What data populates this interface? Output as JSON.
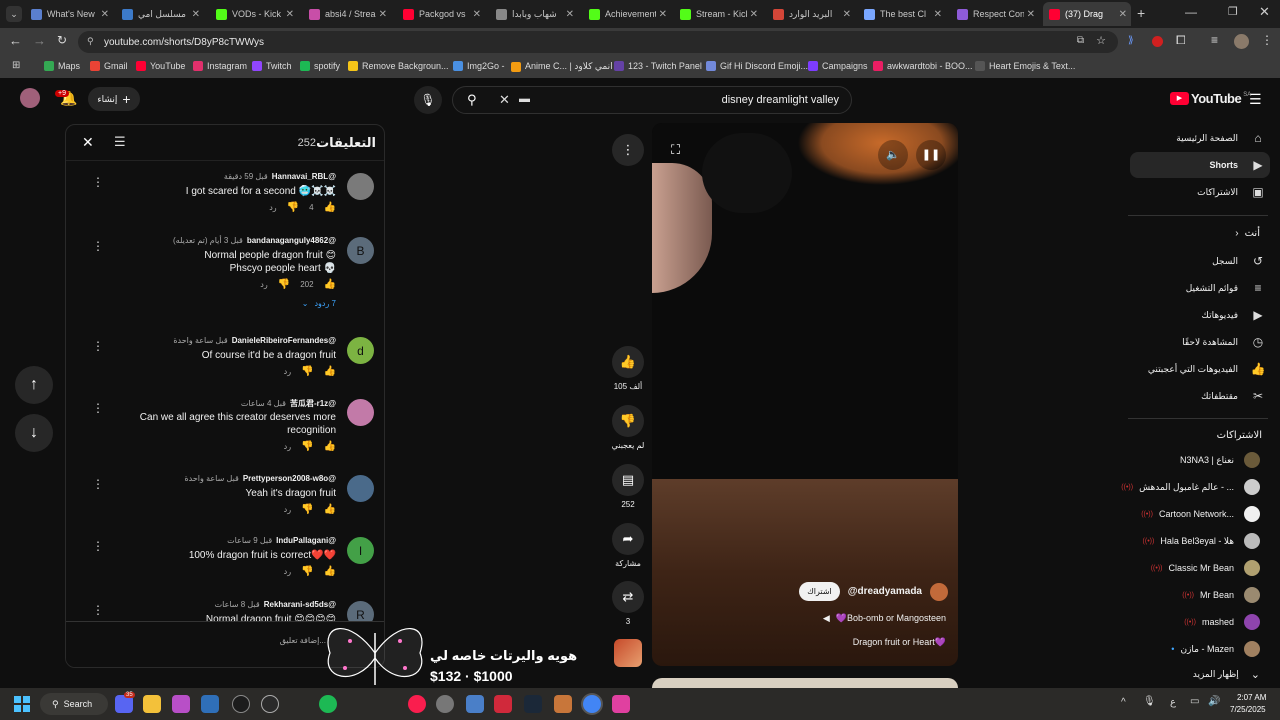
{
  "browser": {
    "tabs": [
      {
        "title": "What's New",
        "color": "#5a7fcf"
      },
      {
        "title": "مسلسل امي",
        "color": "#3c7ac9"
      },
      {
        "title": "VODs - Kick",
        "color": "#53fc18"
      },
      {
        "title": "absi4 / Stream",
        "color": "#c84ea8"
      },
      {
        "title": "Packgod vs",
        "color": "#ff0033"
      },
      {
        "title": "شهاب وبابدا",
        "color": "#888888"
      },
      {
        "title": "Achievements",
        "color": "#53fc18"
      },
      {
        "title": "Stream - Kick",
        "color": "#53fc18"
      },
      {
        "title": "البريد الوارد",
        "color": "#d44638"
      },
      {
        "title": "The best Cl",
        "color": "#7aa7ff"
      },
      {
        "title": "Respect Con",
        "color": "#8e5bd8"
      },
      {
        "title": "(37) Drag",
        "color": "#ff0033"
      }
    ],
    "url": "youtube.com/shorts/D8yP8cTWWys",
    "bookmarks": [
      {
        "label": "Maps",
        "color": "#34a853"
      },
      {
        "label": "Gmail",
        "color": "#ea4335"
      },
      {
        "label": "YouTube",
        "color": "#ff0033"
      },
      {
        "label": "Instagram",
        "color": "#e1306c"
      },
      {
        "label": "Twitch",
        "color": "#9146ff"
      },
      {
        "label": "spotify",
        "color": "#1db954"
      },
      {
        "label": "Remove Backgroun...",
        "color": "#f5c518"
      },
      {
        "label": "Img2Go -",
        "color": "#4a90e2"
      },
      {
        "label": "Anime C... | انمي كلاود",
        "color": "#f39c12"
      },
      {
        "label": "123 - Twitch Panel",
        "color": "#6441a5"
      },
      {
        "label": "Gif Hi Discord Emoji...",
        "color": "#7289da"
      },
      {
        "label": "Campaigns",
        "color": "#7d3cff"
      },
      {
        "label": "awkwardtobi - BOO...",
        "color": "#e91e63"
      },
      {
        "label": "Heart Emojis & Text...",
        "color": "#555555"
      }
    ]
  },
  "youtube": {
    "logo_text": "YouTube",
    "logo_region": "SA",
    "create_label": "إنشاء",
    "notif_count": "+9",
    "search_query": "disney dreamlight valley"
  },
  "comments": {
    "title": "التعليقات",
    "count": "252",
    "items": [
      {
        "user": "@Hannavai_RBL",
        "time": "قبل 59 دقيقة",
        "lines": [
          "I got scared for a second 🥶☠️☠️"
        ],
        "likes": "4",
        "reply": "رد",
        "avatar_color": "#7a7a7a",
        "avatar_letter": ""
      },
      {
        "user": "@bandanaganguly4862",
        "time": "قبل 3 أيام (تم تعديله)",
        "lines": [
          "Normal people dragon fruit 😊",
          "Phscyo people heart 💀"
        ],
        "likes": "202",
        "reply": "رد",
        "replies": "7 ردود",
        "avatar_color": "#5b6b7a",
        "avatar_letter": "B"
      },
      {
        "user": "@DanieleRibeiroFernandes",
        "time": "قبل ساعة واحدة",
        "lines": [
          "Of course it'd be a dragon fruit"
        ],
        "likes": "",
        "reply": "رد",
        "avatar_color": "#7cb342",
        "avatar_letter": "d"
      },
      {
        "user": "@苦瓜君-r1z",
        "time": "قبل 4 ساعات",
        "lines": [
          "Can we all agree this creator deserves more",
          "recognition"
        ],
        "likes": "",
        "reply": "رد",
        "avatar_color": "#c27aa8",
        "avatar_letter": ""
      },
      {
        "user": "@Prettyperson2008-w8o",
        "time": "قبل ساعة واحدة",
        "lines": [
          "Yeah it's dragon fruit"
        ],
        "likes": "",
        "reply": "رد",
        "avatar_color": "#4a6a8a",
        "avatar_letter": ""
      },
      {
        "user": "@InduPallagani",
        "time": "قبل 9 ساعات",
        "lines": [
          "100% dragon fruit is correct❤️❤️"
        ],
        "likes": "",
        "reply": "رد",
        "avatar_color": "#43a047",
        "avatar_letter": "I"
      },
      {
        "user": "@Rekharani-sd5ds",
        "time": "قبل 8 ساعات",
        "lines": [
          "Normal dragon fruit 😊😊😊😊"
        ],
        "likes": "",
        "reply": "",
        "avatar_color": "#5b6b7a",
        "avatar_letter": "R"
      }
    ],
    "add_placeholder": "إضافة تعليق..."
  },
  "short": {
    "channel": "@dreadyamada",
    "subscribe_label": "اشتراك",
    "description": "💜Bob-omb or Mangosteen",
    "caption": "Dragon fruit or Heart💜",
    "likes": "105 ألف",
    "dislike_label": "لم يعجبني",
    "comments": "252",
    "share_label": "مشاركة",
    "remix": "3"
  },
  "overlay": {
    "text": "هويه واليرتات خاصه لي",
    "price": "$132 · $1000"
  },
  "sidebar": {
    "main": [
      {
        "label": "الصفحة الرئيسية",
        "icon": "home-icon",
        "glyph": "⌂"
      },
      {
        "label": "Shorts",
        "icon": "shorts-icon",
        "glyph": "▶"
      },
      {
        "label": "الاشتراكات",
        "icon": "subscriptions-icon",
        "glyph": "▣"
      }
    ],
    "you_label": "أنت",
    "you": [
      {
        "label": "السجل",
        "icon": "history-icon",
        "glyph": "↺"
      },
      {
        "label": "قوائم التشغيل",
        "icon": "playlist-icon",
        "glyph": "≡"
      },
      {
        "label": "فيديوهاتك",
        "icon": "your-videos-icon",
        "glyph": "▶"
      },
      {
        "label": "المشاهدة لاحقًا",
        "icon": "clock-icon",
        "glyph": "◷"
      },
      {
        "label": "الفيديوهات التي أعجبتني",
        "icon": "like-icon",
        "glyph": "👍"
      },
      {
        "label": "مقتطفاتك",
        "icon": "scissors-icon",
        "glyph": "✂"
      }
    ],
    "subs_title": "الاشتراكات",
    "subs": [
      {
        "name": "N3NA3 | نعناع",
        "color": "#6a5a3a",
        "status": ""
      },
      {
        "name": "عالم غامبول المدهش - ...",
        "color": "#cccccc",
        "status": "live"
      },
      {
        "name": "Cartoon Network...",
        "color": "#f0f0f0",
        "status": "live"
      },
      {
        "name": "Hala Bel3eyal - هلا",
        "color": "#bbbbbb",
        "status": "live"
      },
      {
        "name": "Classic Mr Bean",
        "color": "#b0a070",
        "status": "live"
      },
      {
        "name": "Mr Bean",
        "color": "#9a8a70",
        "status": "live"
      },
      {
        "name": "mashed",
        "color": "#8e44ad",
        "status": "live"
      },
      {
        "name": "مازن - Mazen",
        "color": "#a08060",
        "status": "dot"
      }
    ],
    "show_more": "إظهار المزيد"
  },
  "taskbar": {
    "search": "Search",
    "time": "2:07 AM",
    "date": "7/25/2025",
    "lang": "ع",
    "badge": "35"
  }
}
